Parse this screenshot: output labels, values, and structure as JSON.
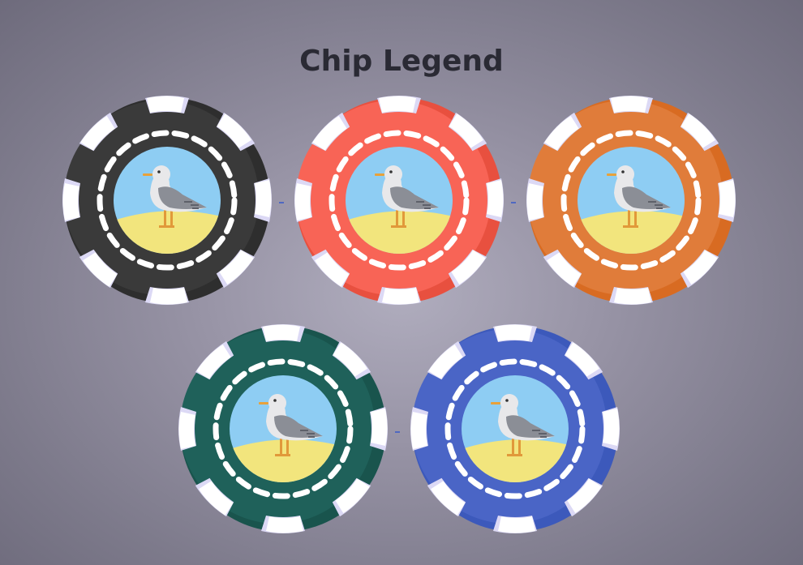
{
  "page": {
    "title": "Chip Legend"
  },
  "chips": [
    {
      "name": "chip-black",
      "color": "#3a3a3a",
      "shade": "#2e2e2e",
      "label": ""
    },
    {
      "name": "chip-red",
      "color": "#f86456",
      "shade": "#e8503f",
      "label": ""
    },
    {
      "name": "chip-orange",
      "color": "#e07c3a",
      "shade": "#d86b22",
      "label": ""
    },
    {
      "name": "chip-green",
      "color": "#1f615a",
      "shade": "#19544d",
      "label": ""
    },
    {
      "name": "chip-blue",
      "color": "#4a65c6",
      "shade": "#3c59bb",
      "label": ""
    }
  ],
  "colors": {
    "notch": "#ffffff",
    "notch_shadow": "#dcd9f5",
    "dash": "#ffffff",
    "sky": "#8ecdf3",
    "sand": "#f2e57d",
    "seagull_body": "#e8e8ea",
    "seagull_wing": "#8b8e96",
    "beak": "#e8a13a",
    "legs": "#e1993a"
  },
  "icons": {
    "center_art": "seagull-icon"
  }
}
